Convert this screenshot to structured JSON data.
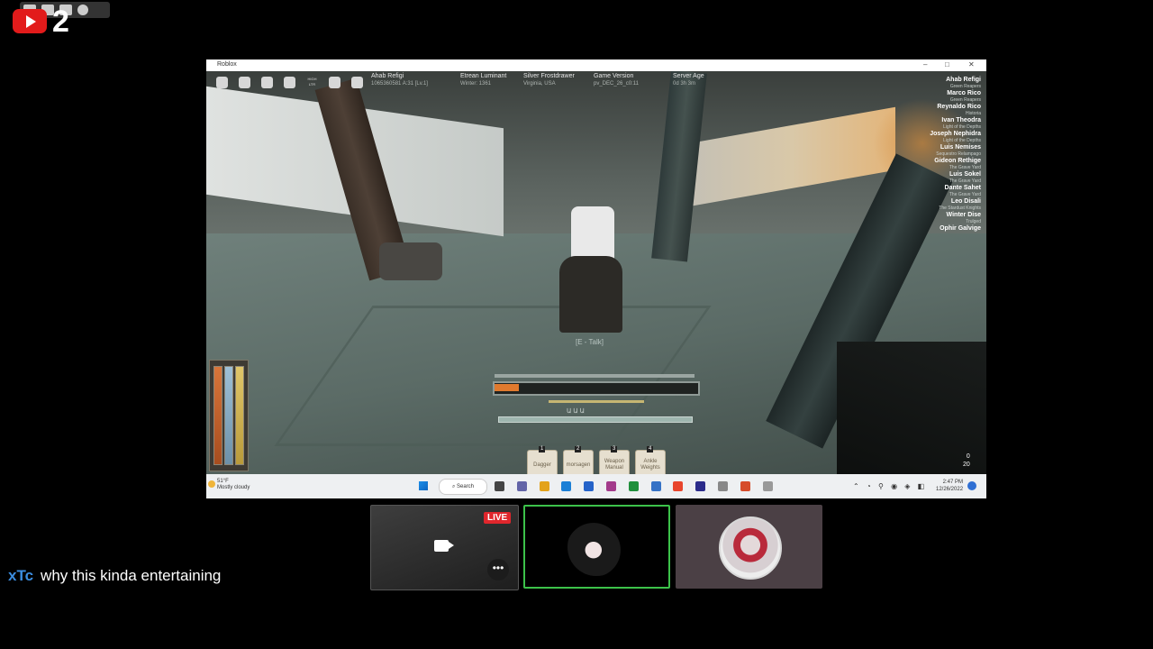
{
  "overlay": {
    "viewer_count": "2"
  },
  "window": {
    "title": "Roblox",
    "controls": [
      "–",
      "□",
      "✕"
    ]
  },
  "hud": {
    "menu_icons": [
      "roblox-menu-icon",
      "chat-icon",
      "backpack-icon",
      "music-icon",
      "high-ltr-icon",
      "scroll-icon",
      "help-icon"
    ],
    "high_ltr_label": "HIGH LTR",
    "info": [
      {
        "title": "Ahab Refigi",
        "sub": "1065360581 A:31 [Lv.1]"
      },
      {
        "title": "Etrean Luminant",
        "sub": "Winter: 1361"
      },
      {
        "title": "Silver Frostdrawer",
        "sub": "Virginia, USA"
      },
      {
        "title": "Game Version",
        "sub": "pv_DEC_26_c0:11"
      },
      {
        "title": "Server Age",
        "sub": "0d 3h 3m"
      }
    ]
  },
  "player_list": [
    {
      "name": "Ahab Refigi",
      "family": "Green Reapers"
    },
    {
      "name": "Marco Rico",
      "family": "Green Reapers"
    },
    {
      "name": "Reynaldo Rico",
      "family": "Historia"
    },
    {
      "name": "Ivan Theodra",
      "family": "Light of the Depths"
    },
    {
      "name": "Joseph Nephidra",
      "family": "Light of the Depths"
    },
    {
      "name": "Luis Nemises",
      "family": "Sequestro Relampago"
    },
    {
      "name": "Gideon Rethige",
      "family": "The Grave Yard"
    },
    {
      "name": "Luis Sokel",
      "family": "The Grave Yard"
    },
    {
      "name": "Dante Sahet",
      "family": "The Grave Yard"
    },
    {
      "name": "Leo Disali",
      "family": "The Stardust Knights"
    },
    {
      "name": "Winter Dise",
      "family": "Trulged"
    },
    {
      "name": "Ophir Galvige",
      "family": ""
    }
  ],
  "world": {
    "interact_tag": "[E - Talk]"
  },
  "bars": {
    "cast_fill_percent": 12,
    "cast_label": "Ա  Ա  Ա"
  },
  "hotbar": [
    {
      "key": "1",
      "label": "Dagger"
    },
    {
      "key": "2",
      "label": "morsagen"
    },
    {
      "key": "3",
      "label": "Weapon Manual"
    },
    {
      "key": "4",
      "label": "Ankle Weights"
    }
  ],
  "stats": {
    "line1": "0",
    "line2": "20"
  },
  "taskbar": {
    "weather_temp": "51°F",
    "weather_desc": "Mostly cloudy",
    "search": "Search",
    "time": "2:47 PM",
    "date": "12/26/2022",
    "app_colors": [
      "#444444",
      "#6264a7",
      "#e3a21a",
      "#1b7fd6",
      "#2563c9",
      "#a33b8b",
      "#1f8f3c",
      "#3572c6",
      "#e8452c",
      "#2b2b8a",
      "#888888",
      "#d64c2a",
      "#999999"
    ]
  },
  "tiles": {
    "live_label": "LIVE",
    "more_label": "•••"
  },
  "chat": {
    "name": "xTc",
    "message": "why this kinda entertaining"
  },
  "colors": {
    "accent_green": "#3cc24a",
    "live_red": "#e0262c",
    "youtube_red": "#e21b1b",
    "chat_name_blue": "#3b8de0"
  }
}
